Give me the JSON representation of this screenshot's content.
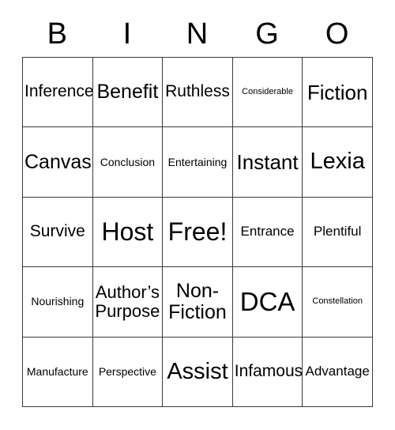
{
  "header": {
    "letters": [
      "B",
      "I",
      "N",
      "G",
      "O"
    ]
  },
  "grid": {
    "rows": [
      [
        {
          "text": "Inference",
          "size": "fs-lg"
        },
        {
          "text": "Benefit",
          "size": "fs-2xl"
        },
        {
          "text": "Ruthless",
          "size": "fs-lg"
        },
        {
          "text": "Considerable",
          "size": "fs-xs"
        },
        {
          "text": "Fiction",
          "size": "fs-3xl"
        }
      ],
      [
        {
          "text": "Canvas",
          "size": "fs-2xl"
        },
        {
          "text": "Conclusion",
          "size": "fs-sm"
        },
        {
          "text": "Entertaining",
          "size": "fs-sm"
        },
        {
          "text": "Instant",
          "size": "fs-3xl"
        },
        {
          "text": "Lexia",
          "size": "fs-4xl"
        }
      ],
      [
        {
          "text": "Survive",
          "size": "fs-lg"
        },
        {
          "text": "Host",
          "size": "fs-5xl"
        },
        {
          "text": "Free!",
          "size": "fs-5xl"
        },
        {
          "text": "Entrance",
          "size": "fs-md"
        },
        {
          "text": "Plentiful",
          "size": "fs-md"
        }
      ],
      [
        {
          "text": "Nourishing",
          "size": "fs-sm"
        },
        {
          "text": "Author’s Purpose",
          "size": "fs-xl"
        },
        {
          "text": "Non-Fiction",
          "size": "fs-2xl"
        },
        {
          "text": "DCA",
          "size": "fs-6xl"
        },
        {
          "text": "Constellation",
          "size": "fs-xs"
        }
      ],
      [
        {
          "text": "Manufacture",
          "size": "fs-sm"
        },
        {
          "text": "Perspective",
          "size": "fs-sm"
        },
        {
          "text": "Assist",
          "size": "fs-4xl"
        },
        {
          "text": "Infamous",
          "size": "fs-lg"
        },
        {
          "text": "Advantage",
          "size": "fs-md"
        }
      ]
    ]
  },
  "colors": {
    "border": "#3a3a3a",
    "text": "#000000",
    "background": "#ffffff"
  }
}
